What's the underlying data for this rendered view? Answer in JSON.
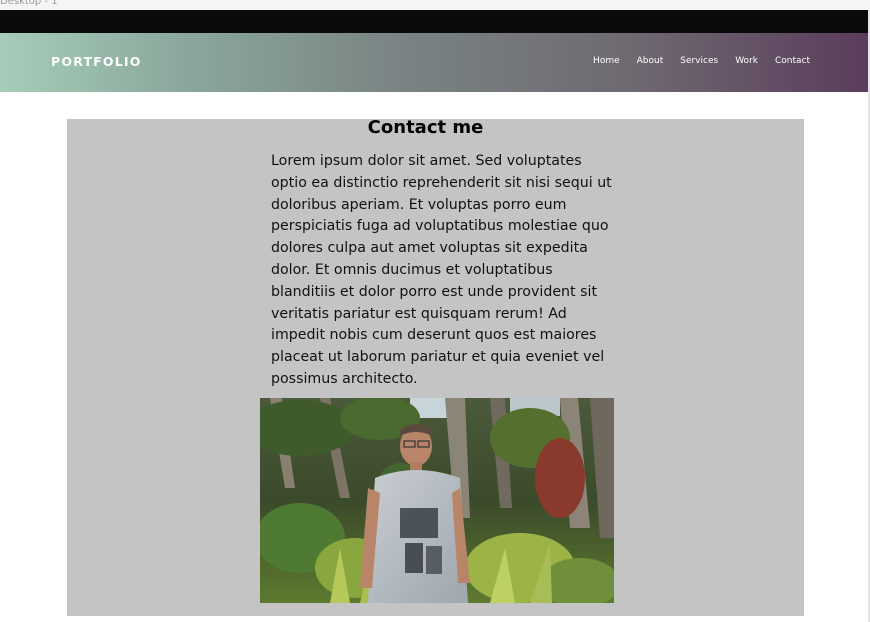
{
  "canvas": {
    "frame_label": "Desktop - 1"
  },
  "header": {
    "brand": "PORTFOLIO",
    "nav": [
      "Home",
      "About",
      "Services",
      "Work",
      "Contact"
    ]
  },
  "contact": {
    "title": "Contact me",
    "body": "Lorem ipsum dolor sit amet. Sed voluptates optio ea distinctio reprehenderit sit nisi sequi ut doloribus aperiam. Et voluptas porro eum perspiciatis fuga ad voluptatibus molestiae quo dolores culpa aut amet voluptas sit expedita dolor. Et omnis ducimus et voluptatibus blanditiis et dolor porro est unde provident sit veritatis pariatur est quisquam rerum! Ad impedit nobis cum deserunt quos est maiores placeat ut laborum pariatur et quia eveniet vel possimus architecto."
  },
  "colors": {
    "topbar": "#0b0b0b",
    "gradient_start": "#a5cdb9",
    "gradient_end": "#5a3d5b",
    "section_bg": "#c4c4c4"
  }
}
